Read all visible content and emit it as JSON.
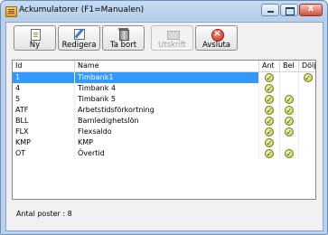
{
  "window": {
    "title": "Ackumulatorer (F1=Manualen)",
    "close_glyph": "x"
  },
  "toolbar": {
    "buttons": [
      {
        "label": "Ny",
        "icon": "new-document-icon",
        "enabled": true
      },
      {
        "label": "Redigera",
        "icon": "edit-icon",
        "enabled": true
      },
      {
        "label": "Ta bort",
        "icon": "trash-icon",
        "enabled": true
      },
      {
        "label": "Utskrift",
        "icon": "printer-icon",
        "enabled": false
      },
      {
        "label": "Avsluta",
        "icon": "exit-icon",
        "enabled": true
      }
    ]
  },
  "grid": {
    "columns": [
      "Id",
      "Name",
      "Ant",
      "Bel",
      "Dölj"
    ],
    "check_glyph": "✓",
    "rows": [
      {
        "id": "1",
        "name": "Timbank1",
        "ant": true,
        "bel": false,
        "dolj": true,
        "selected": true
      },
      {
        "id": "4",
        "name": "Timbank 4",
        "ant": true,
        "bel": false,
        "dolj": false,
        "selected": false
      },
      {
        "id": "5",
        "name": "Timbank 5",
        "ant": true,
        "bel": true,
        "dolj": false,
        "selected": false
      },
      {
        "id": "ATF",
        "name": "Arbetstidsförkortning",
        "ant": true,
        "bel": true,
        "dolj": false,
        "selected": false
      },
      {
        "id": "BLL",
        "name": "Barnledighetslön",
        "ant": true,
        "bel": true,
        "dolj": false,
        "selected": false
      },
      {
        "id": "FLX",
        "name": "Flexsaldo",
        "ant": true,
        "bel": true,
        "dolj": false,
        "selected": false
      },
      {
        "id": "KMP",
        "name": "KMP",
        "ant": true,
        "bel": false,
        "dolj": false,
        "selected": false
      },
      {
        "id": "OT",
        "name": "Övertid",
        "ant": true,
        "bel": true,
        "dolj": false,
        "selected": false
      }
    ]
  },
  "status": {
    "text": "Antal poster : 8"
  }
}
